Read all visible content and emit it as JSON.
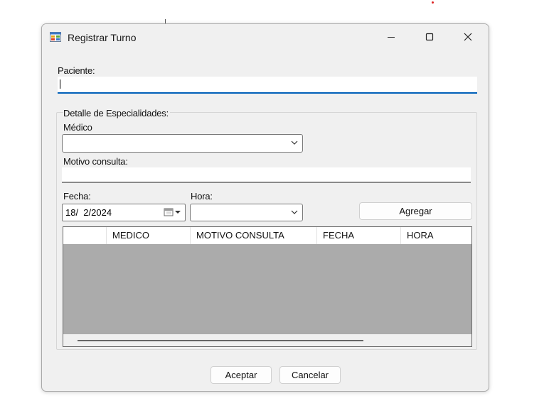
{
  "window": {
    "title": "Registrar Turno",
    "controls": {
      "minimize": "—",
      "maximize": "☐",
      "close": "✕"
    }
  },
  "form": {
    "paciente_label": "Paciente:",
    "paciente_value": ""
  },
  "group": {
    "title": "Detalle de Especialidades:",
    "medico_label": "Médico",
    "medico_value": "",
    "motivo_label": "Motivo consulta:",
    "motivo_value": "",
    "fecha_label": "Fecha:",
    "fecha_value": "18/  2/2024",
    "hora_label": "Hora:",
    "hora_value": "",
    "agregar_button": "Agregar",
    "grid": {
      "columns": [
        "",
        "MEDICO",
        "MOTIVO CONSULTA",
        "FECHA",
        "HORA"
      ],
      "rows": []
    }
  },
  "buttons": {
    "aceptar": "Aceptar",
    "cancelar": "Cancelar"
  },
  "colors": {
    "accent_underline": "#005fb8",
    "grid_background": "#ababab",
    "window_bg": "#f0f0f0"
  }
}
